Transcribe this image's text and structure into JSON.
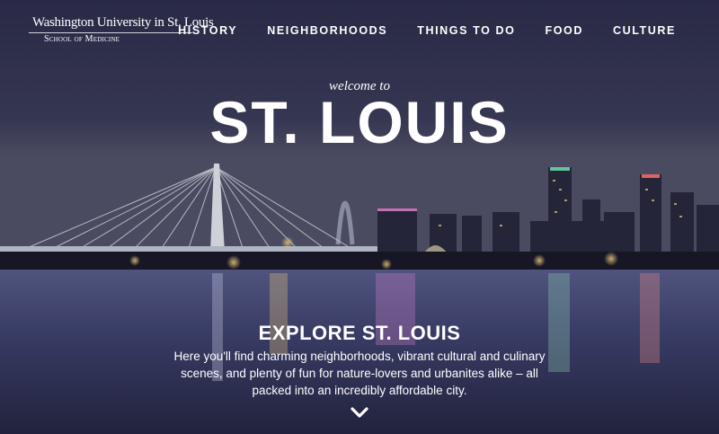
{
  "logo": {
    "name": "Washington University in St. Louis",
    "subtitle": "School of Medicine"
  },
  "nav": {
    "items": [
      "HISTORY",
      "NEIGHBORHOODS",
      "THINGS TO DO",
      "FOOD",
      "CULTURE"
    ]
  },
  "hero": {
    "welcome": "welcome to",
    "title": "ST. LOUIS"
  },
  "explore": {
    "heading": "EXPLORE ST. LOUIS",
    "description": "Here you'll find charming neighborhoods, vibrant cultural and culinary scenes, and plenty of fun for nature-lovers and urbanites alike – all packed into an incredibly affordable city."
  },
  "icons": {
    "scroll": "chevron-down-icon",
    "crest": "crest-icon"
  },
  "colors": {
    "sky_top": "#3a3b57",
    "sky_horizon": "#4a4b6a",
    "water": "#3c3f6e",
    "text": "#ffffff"
  }
}
